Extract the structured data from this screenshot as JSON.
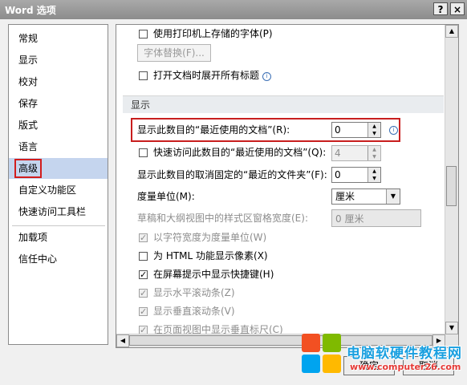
{
  "window": {
    "title": "Word 选项",
    "help_label": "?",
    "close_label": "×"
  },
  "sidebar": {
    "items": [
      {
        "label": "常规"
      },
      {
        "label": "显示"
      },
      {
        "label": "校对"
      },
      {
        "label": "保存"
      },
      {
        "label": "版式"
      },
      {
        "label": "语言"
      },
      {
        "label": "高级"
      },
      {
        "label": "自定义功能区"
      },
      {
        "label": "快速访问工具栏"
      },
      {
        "label": "加载项"
      },
      {
        "label": "信任中心"
      }
    ],
    "selected": "高级"
  },
  "content": {
    "print_fonts_label": "使用打印机上存储的字体(P)",
    "font_substitution_label": "字体替换(F)...",
    "expand_headings_label": "打开文档时展开所有标题",
    "display_section_title": "显示",
    "recent_docs": {
      "label": "显示此数目的“最近使用的文档”(R):",
      "value": "0"
    },
    "quick_access_recent": {
      "label": "快速访问此数目的“最近使用的文档”(Q):",
      "value": "4"
    },
    "recent_folders": {
      "label": "显示此数目的取消固定的“最近的文件夹”(F):",
      "value": "0"
    },
    "measurement_units": {
      "label": "度量单位(M):",
      "value": "厘米"
    },
    "style_area_width": {
      "label": "草稿和大纲视图中的样式区窗格宽度(E):",
      "value": "0 厘米"
    },
    "char_width_units_label": "以字符宽度为度量单位(W)",
    "html_pixels_label": "为 HTML 功能显示像素(X)",
    "shortcut_keys_label": "在屏幕提示中显示快捷键(H)",
    "h_scrollbar_label": "显示水平滚动条(Z)",
    "v_scrollbar_label": "显示垂直滚动条(V)",
    "v_ruler_label": "在页面视图中显示垂直标尺(C)"
  },
  "footer": {
    "ok_label": "确定",
    "cancel_label": "取消"
  },
  "watermark": {
    "title": "电脑软硬件教程网",
    "url": "www.computer26.com"
  }
}
